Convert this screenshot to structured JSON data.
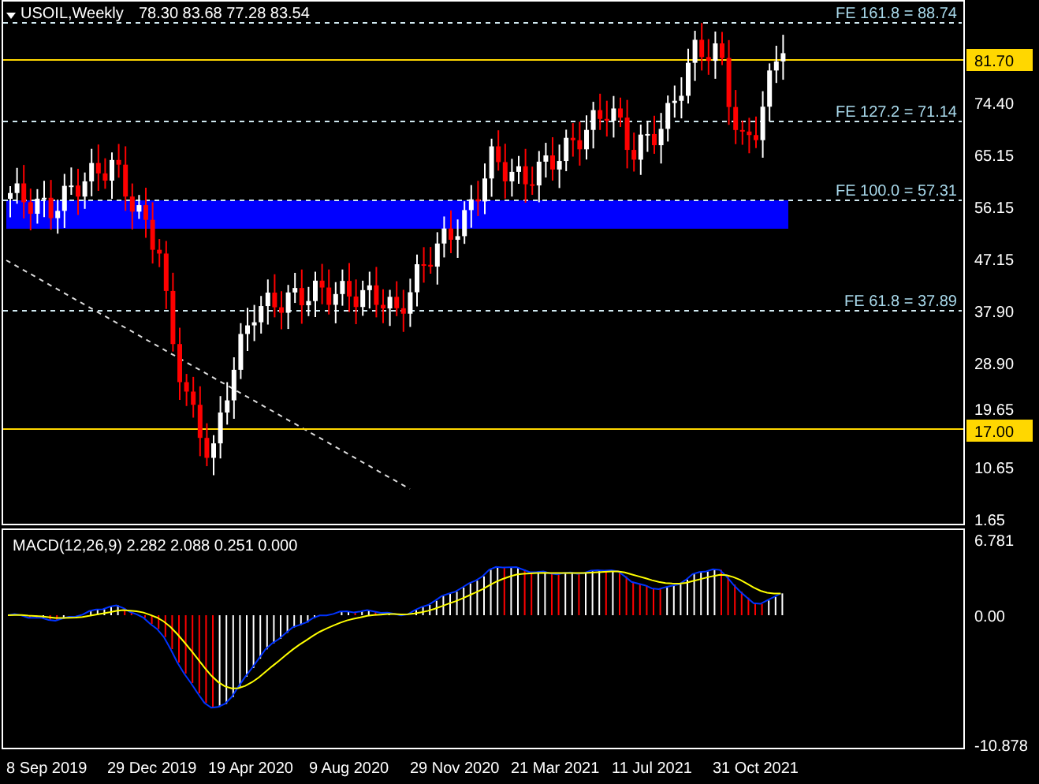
{
  "chart_header": {
    "symbol": "USOIL,Weekly",
    "ohlc": "78.30 83.68 77.28 83.54"
  },
  "price_axis": [
    {
      "label": "81.70",
      "kind": "highlight"
    },
    {
      "label": "74.40",
      "kind": "plain"
    },
    {
      "label": "65.15",
      "kind": "plain"
    },
    {
      "label": "56.15",
      "kind": "plain"
    },
    {
      "label": "47.15",
      "kind": "plain"
    },
    {
      "label": "37.90",
      "kind": "plain"
    },
    {
      "label": "28.90",
      "kind": "plain"
    },
    {
      "label": "19.65",
      "kind": "plain"
    },
    {
      "label": "17.00",
      "kind": "highlight"
    },
    {
      "label": "10.65",
      "kind": "plain"
    },
    {
      "label": "1.65",
      "kind": "plain"
    }
  ],
  "fibo_levels": [
    {
      "label": "FE 161.8 = 88.74"
    },
    {
      "label": "FE 127.2 = 71.14"
    },
    {
      "label": "FE 100.0 = 57.31"
    },
    {
      "label": "FE 61.8 = 37.89"
    }
  ],
  "macd": {
    "label": "MACD(12,26,9) 2.282 2.088 0.251 0.000",
    "axis": [
      "6.781",
      "0.00",
      "-10.878"
    ]
  },
  "time_axis": [
    "8 Sep 2019",
    "29 Dec 2019",
    "19 Apr 2020",
    "9 Aug 2020",
    "29 Nov 2020",
    "21 Mar 2021",
    "11 Jul 2021",
    "31 Oct 2021"
  ]
}
